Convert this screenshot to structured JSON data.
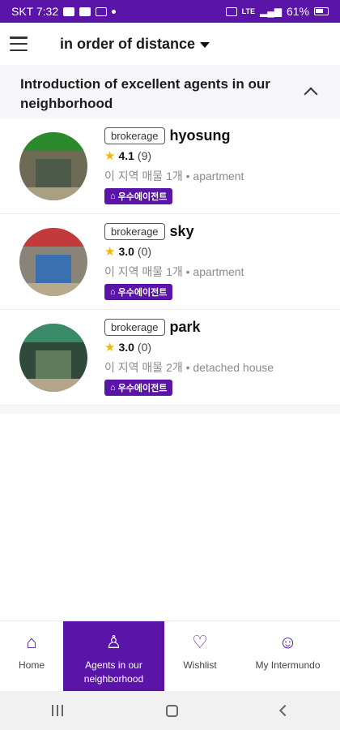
{
  "status_bar": {
    "carrier_time": "SKT 7:32",
    "signal_text": "LTE",
    "battery": "61%"
  },
  "header": {
    "sort_label": "in order of distance"
  },
  "section": {
    "title": "Introduction of excellent agents in our neighborhood",
    "agents": [
      {
        "badge": "brokerage",
        "name": "hyosung",
        "rating": "4.1",
        "reviews": "(9)",
        "meta": "이 지역 매물 1개 • apartment",
        "tag": "우수에이전트",
        "photo_colors": [
          "#2b8a2e",
          "#6d6a55",
          "#a8a080"
        ]
      },
      {
        "badge": "brokerage",
        "name": "sky",
        "rating": "3.0",
        "reviews": "(0)",
        "meta": "이 지역 매물 1개 • apartment",
        "tag": "우수에이전트",
        "photo_colors": [
          "#c23a3a",
          "#3a6fb0",
          "#b8a98a"
        ]
      },
      {
        "badge": "brokerage",
        "name": "park",
        "rating": "3.0",
        "reviews": "(0)",
        "meta": "이 지역 매물 2개 • detached house",
        "tag": "우수에이전트",
        "photo_colors": [
          "#3a8a6a",
          "#2f4a3a",
          "#b2a58c"
        ]
      }
    ]
  },
  "bottom_nav": {
    "items": [
      {
        "label": "Home",
        "icon": "home-icon"
      },
      {
        "label": "Agents in our neighborhood",
        "icon": "person-icon"
      },
      {
        "label": "Wishlist",
        "icon": "heart-icon"
      },
      {
        "label": "My Intermundo",
        "icon": "user-circle-icon"
      }
    ]
  },
  "colors": {
    "brand": "#5a14a8",
    "star": "#f5b50a"
  }
}
